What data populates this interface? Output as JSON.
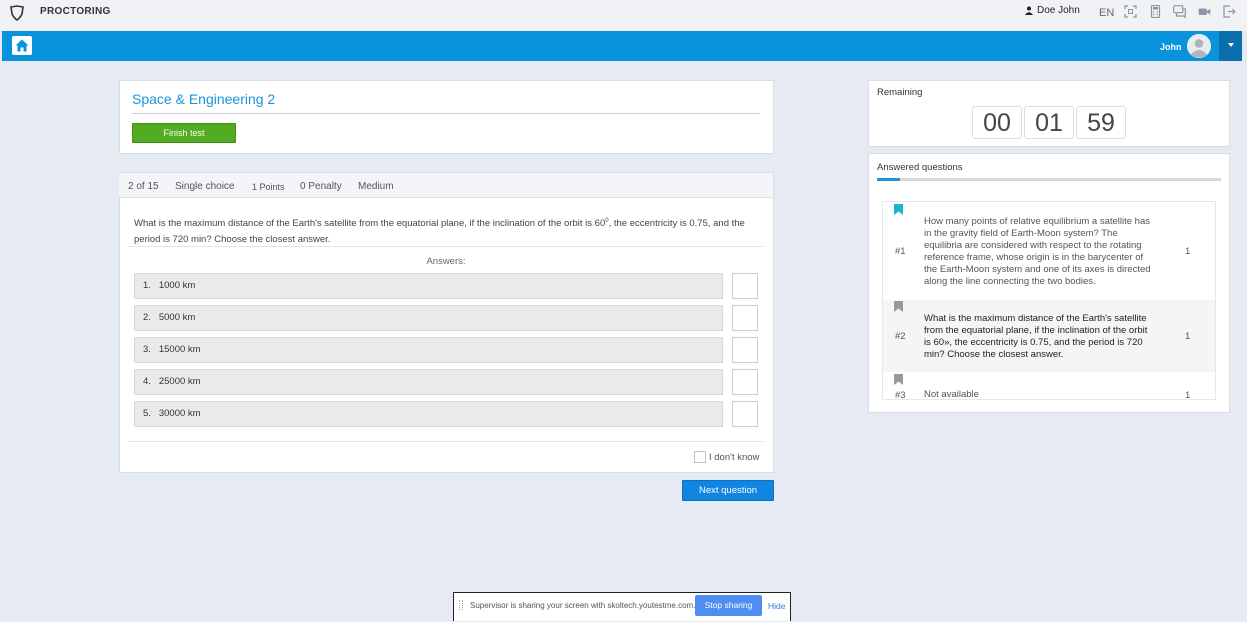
{
  "header": {
    "brand": "PROCTORING",
    "user_name": "Doe John",
    "language": "EN",
    "icons": [
      "fullscreen-icon",
      "calculator-icon",
      "chat-icon",
      "camera-icon",
      "logout-icon"
    ]
  },
  "navbar": {
    "user_first_name": "John",
    "home_icon": "home-icon",
    "dropdown_icon": "caret-down-icon"
  },
  "test": {
    "title": "Space & Engineering 2",
    "finish_label": "Finish test"
  },
  "question": {
    "position": "2 of 15",
    "type": "Single choice",
    "points": "1 Points",
    "penalty": "0 Penalty",
    "difficulty": "Medium",
    "text_before_degree": "What is the maximum distance of the Earth's satellite from the equatorial plane, if the inclination of the orbit is 60",
    "degree": "0",
    "text_after_degree": ", the eccentricity is 0.75, and the period is 720 min? Choose the closest answer.",
    "answers_label": "Answers:",
    "answers": [
      {
        "num": "1.",
        "text": "1000 km"
      },
      {
        "num": "2.",
        "text": "5000 km"
      },
      {
        "num": "3.",
        "text": "15000 km"
      },
      {
        "num": "4.",
        "text": "25000 km"
      },
      {
        "num": "5.",
        "text": "30000 km"
      }
    ],
    "dont_know_label": "I don't know",
    "next_label": "Next question"
  },
  "timer": {
    "label": "Remaining",
    "hours": "00",
    "minutes": "01",
    "seconds": "59"
  },
  "answered": {
    "label": "Answered questions",
    "progress_fraction": 0.067,
    "accent_color": "#1a94d8",
    "items": [
      {
        "num": "#1",
        "text": "How many points of relative equilibrium a satellite has in the gravity field of Earth-Moon system? The equilibria are considered with respect to the rotating reference frame, whose origin is in the barycenter of the Earth-Moon system and one of its axes is directed along the line connecting the two bodies.",
        "points": "1",
        "bookmark_color": "#1ab6c8"
      },
      {
        "num": "#2",
        "text": "What is the maximum distance of the Earth's satellite from the equatorial plane, if the inclination of the orbit is 60», the eccentricity is 0.75, and the period is 720 min? Choose the closest answer.",
        "points": "1",
        "bookmark_color": "#999999"
      },
      {
        "num": "#3",
        "text": "Not available",
        "points": "1",
        "bookmark_color": "#999999"
      }
    ]
  },
  "share_bar": {
    "message": "Supervisor is sharing your screen with skoltech.youtestme.com.",
    "stop_label": "Stop sharing",
    "hide_label": "Hide"
  }
}
